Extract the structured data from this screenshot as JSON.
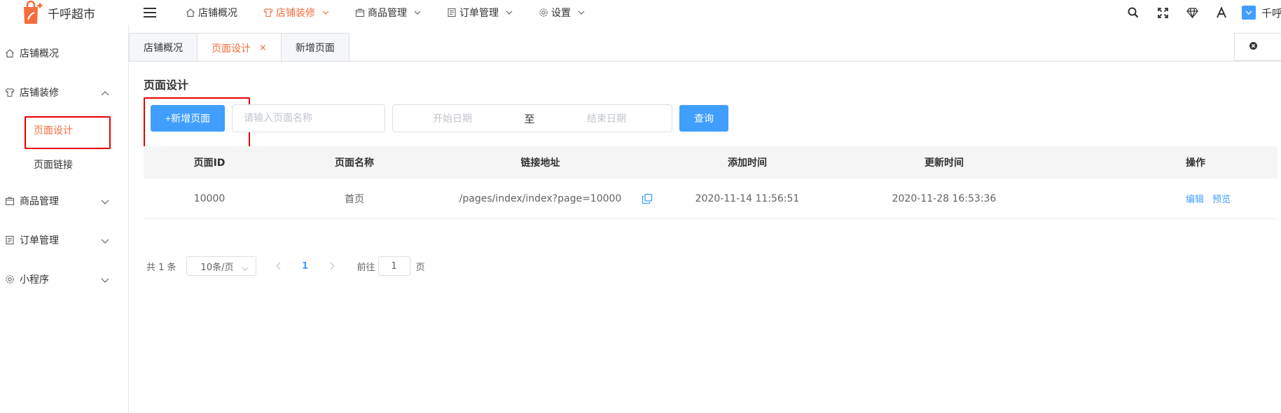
{
  "brand": {
    "name": "千呼超市",
    "color": "#f56c3b"
  },
  "topnav": [
    {
      "label": "店铺概况",
      "icon": "home-icon",
      "active": false,
      "has_dropdown": false
    },
    {
      "label": "店铺装修",
      "icon": "shirt-icon",
      "active": true,
      "has_dropdown": true
    },
    {
      "label": "商品管理",
      "icon": "box-icon",
      "active": false,
      "has_dropdown": true
    },
    {
      "label": "订单管理",
      "icon": "list-icon",
      "active": false,
      "has_dropdown": true
    },
    {
      "label": "设置",
      "icon": "gear-icon",
      "active": false,
      "has_dropdown": true
    }
  ],
  "tools": [
    "search-icon",
    "fullscreen-icon",
    "diamond-icon",
    "font-icon"
  ],
  "user": {
    "name": "千呼"
  },
  "sidebar": {
    "items": [
      {
        "label": "店铺概况",
        "icon": "home-icon"
      },
      {
        "label": "店铺装修",
        "icon": "shirt-icon",
        "expanded": true
      },
      {
        "label": "商品管理",
        "icon": "box-icon"
      },
      {
        "label": "订单管理",
        "icon": "list-icon"
      },
      {
        "label": "小程序",
        "icon": "miniapp-icon"
      }
    ],
    "sub_items": [
      {
        "label": "页面设计",
        "active": true
      },
      {
        "label": "页面链接",
        "active": false
      }
    ]
  },
  "tabs": [
    {
      "label": "店铺概况",
      "active": false,
      "closable": false
    },
    {
      "label": "页面设计",
      "active": true,
      "closable": true
    },
    {
      "label": "新增页面",
      "active": false,
      "closable": false
    }
  ],
  "main": {
    "title": "页面设计",
    "add_button": "+新增页面",
    "name_placeholder": "请输入页面名称",
    "start_placeholder": "开始日期",
    "range_separator": "至",
    "end_placeholder": "结束日期",
    "query_button": "查询"
  },
  "table": {
    "headers": [
      "页面ID",
      "页面名称",
      "链接地址",
      "添加时间",
      "更新时间",
      "操作"
    ],
    "rows": [
      {
        "id": "10000",
        "name": "首页",
        "url": "/pages/index/index?page=10000",
        "created": "2020-11-14 11:56:51",
        "updated": "2020-11-28 16:53:36",
        "actions": [
          "编辑",
          "预览"
        ]
      }
    ]
  },
  "pagination": {
    "total": "共 1 条",
    "page_size": "10条/页",
    "current": "1",
    "goto_label": "前往",
    "goto_value": "1",
    "unit": "页"
  },
  "colors": {
    "primary": "#409eff",
    "accent": "#f56c3b",
    "highlight_box": "#e50000"
  }
}
